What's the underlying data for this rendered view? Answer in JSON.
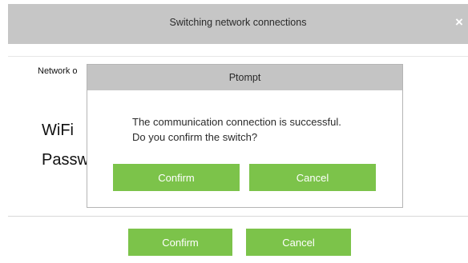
{
  "window": {
    "title": "Switching network connections",
    "close_icon": "close-icon"
  },
  "form": {
    "network_label": "Network o",
    "wifi_label": "WiFi",
    "password_label": "Passw"
  },
  "footer": {
    "confirm_label": "Confirm",
    "cancel_label": "Cancel"
  },
  "prompt": {
    "title": "Ptompt",
    "message_line1": "The communication connection is successful.",
    "message_line2": "Do you confirm the switch?",
    "confirm_label": "Confirm",
    "cancel_label": "Cancel"
  },
  "colors": {
    "button_green": "#7cc34a",
    "titlebar_gray": "#c6c6c6"
  }
}
